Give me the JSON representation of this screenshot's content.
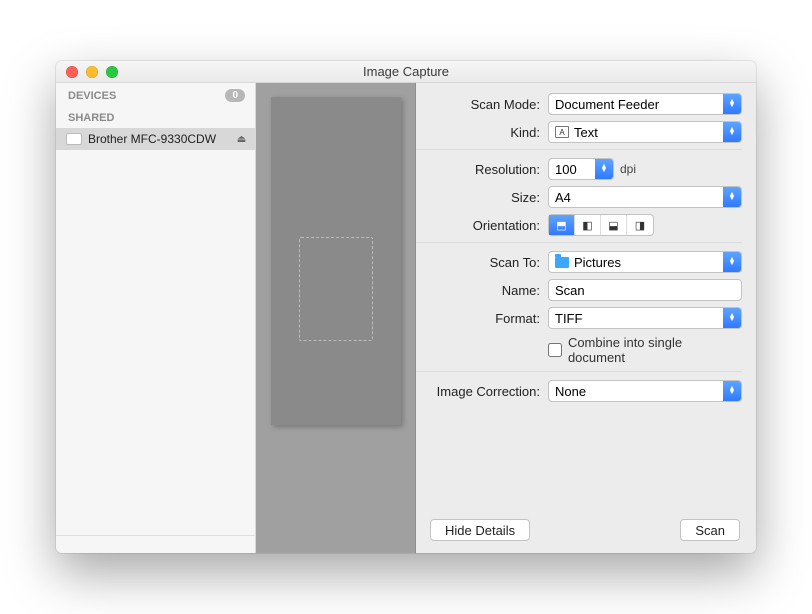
{
  "window": {
    "title": "Image Capture"
  },
  "sidebar": {
    "devices_header": "DEVICES",
    "devices_count": "0",
    "shared_header": "SHARED",
    "device_name": "Brother MFC-9330CDW"
  },
  "labels": {
    "scan_mode": "Scan Mode:",
    "kind": "Kind:",
    "resolution": "Resolution:",
    "size": "Size:",
    "orientation": "Orientation:",
    "scan_to": "Scan To:",
    "name": "Name:",
    "format": "Format:",
    "combine": "Combine into single document",
    "image_correction": "Image Correction:"
  },
  "values": {
    "scan_mode": "Document Feeder",
    "kind": "Text",
    "resolution": "100",
    "resolution_unit": "dpi",
    "size": "A4",
    "scan_to": "Pictures",
    "name": "Scan",
    "format": "TIFF",
    "image_correction": "None"
  },
  "buttons": {
    "hide_details": "Hide Details",
    "scan": "Scan"
  }
}
